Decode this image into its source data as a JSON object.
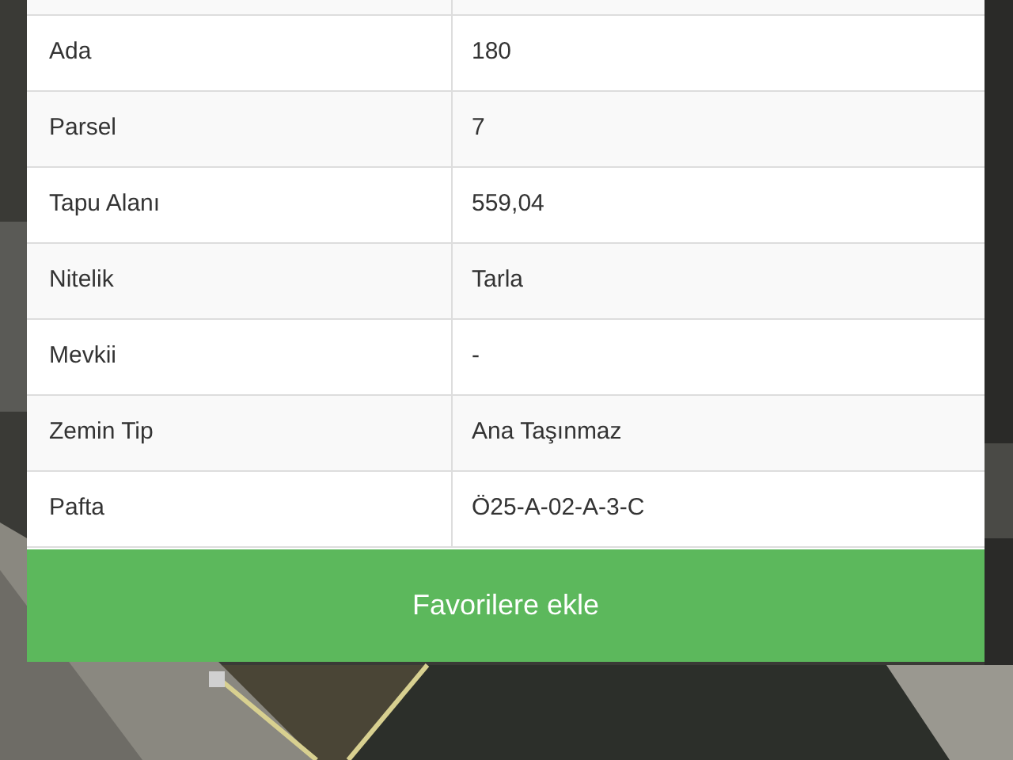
{
  "rows": [
    {
      "label": "Ada",
      "value": "180"
    },
    {
      "label": "Parsel",
      "value": "7"
    },
    {
      "label": "Tapu Alanı",
      "value": "559,04"
    },
    {
      "label": "Nitelik",
      "value": "Tarla"
    },
    {
      "label": "Mevkii",
      "value": "-"
    },
    {
      "label": "Zemin Tip",
      "value": "Ana Taşınmaz"
    },
    {
      "label": "Pafta",
      "value": "Ö25-A-02-A-3-C"
    }
  ],
  "button": {
    "label": "Favorilere ekle"
  }
}
